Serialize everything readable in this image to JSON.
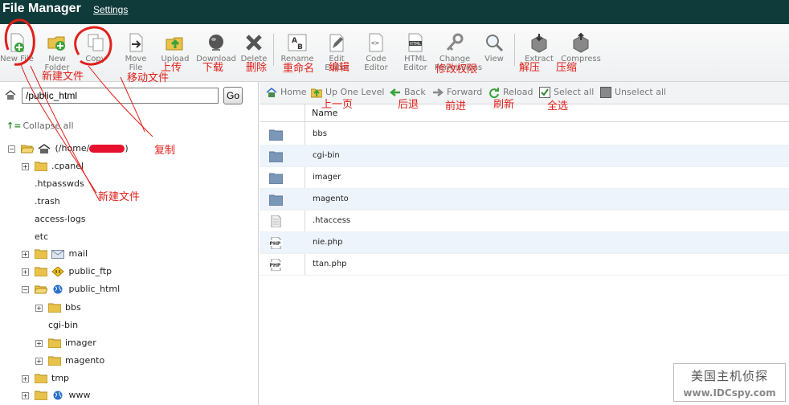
{
  "header": {
    "title": "File Manager",
    "settings_label": "Settings"
  },
  "toolbar": {
    "new_file": "New File",
    "new_folder": "New\nFolder",
    "copy": "Copy",
    "move_file": "Move\nFile",
    "upload": "Upload",
    "download": "Download",
    "delete": "Delete",
    "rename": "Rename",
    "edit": "Edit\nEditor",
    "code_editor": "Code\nEditor",
    "html_editor": "HTML\nEditor",
    "change_permissions": "Change\nPermissions",
    "view": "View",
    "extract": "Extract",
    "compress": "Compress"
  },
  "left": {
    "path_value": "/public_html",
    "go_label": "Go",
    "collapse_label": "Collapse all",
    "root_label_prefix": "(/home/",
    "root_label_suffix": ")",
    "tree": {
      "cpanel": ".cpanel",
      "htpasswds": ".htpasswds",
      "trash": ".trash",
      "access_logs": "access-logs",
      "etc": "etc",
      "mail": "mail",
      "public_ftp": "public_ftp",
      "public_html": "public_html",
      "bbs": "bbs",
      "cgi_bin": "cgi-bin",
      "imager": "imager",
      "magento": "magento",
      "tmp": "tmp",
      "www": "www"
    }
  },
  "right": {
    "nav": {
      "home": "Home",
      "up_one_level": "Up One Level",
      "back": "Back",
      "forward": "Forward",
      "reload": "Reload",
      "select_all": "Select all",
      "unselect_all": "Unselect all"
    },
    "column_name": "Name",
    "files": {
      "f0": "bbs",
      "f1": "cgi-bin",
      "f2": "imager",
      "f3": "magento",
      "f4": ".htaccess",
      "f5": "nie.php",
      "f6": "ttan.php"
    }
  },
  "annotations": {
    "new_file": "新建文件",
    "move_file": "移动文件",
    "copy": "复制",
    "upload": "上传",
    "download": "下载",
    "delete": "删除",
    "rename": "重命名",
    "edit": "编辑",
    "permissions": "修改权限",
    "extract": "解压",
    "compress": "压缩",
    "up_one_level": "上一页",
    "back": "后退",
    "forward": "前进",
    "reload": "刷新",
    "select_all": "全选",
    "new_file_tree": "新建文件"
  },
  "watermark": {
    "line1": "美国主机侦探",
    "line2": "www.IDCspy.com"
  },
  "colors": {
    "header_bg": "#0f3b3a",
    "annotation_red": "#e0201b",
    "row_alt": "#eef4fb"
  }
}
